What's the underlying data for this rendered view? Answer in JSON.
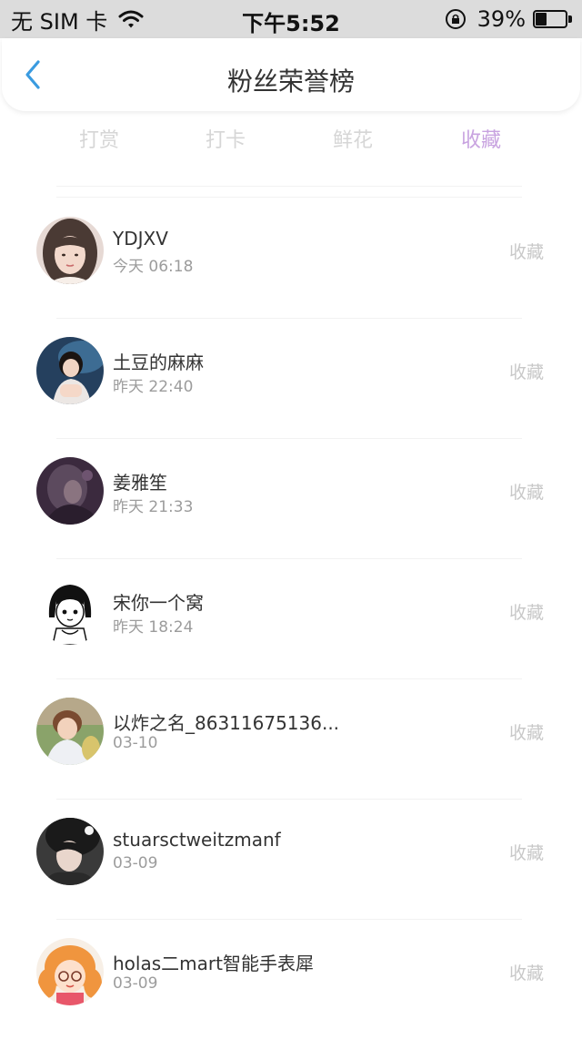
{
  "status_bar": {
    "carrier": "无 SIM 卡",
    "time": "下午5:52",
    "battery_text": "39%",
    "battery_level": 0.39
  },
  "nav": {
    "title": "粉丝荣誉榜",
    "back_icon": "chevron-left-icon"
  },
  "tabs": [
    {
      "label": "打赏",
      "active": false
    },
    {
      "label": "打卡",
      "active": false
    },
    {
      "label": "鲜花",
      "active": false
    },
    {
      "label": "收藏",
      "active": true
    }
  ],
  "colors": {
    "active_tab": "#c8a3e0",
    "inactive_tab": "#d6d6d6",
    "back_arrow": "#3a9be0",
    "action_text": "#c8c8c8"
  },
  "list": [
    {
      "name": "YDJXV",
      "time": "今天 06:18",
      "action": "收藏"
    },
    {
      "name": "土豆的麻麻",
      "time": "昨天 22:40",
      "action": "收藏"
    },
    {
      "name": "姜雅笙",
      "time": "昨天 21:33",
      "action": "收藏"
    },
    {
      "name": "宋你一个窝",
      "time": "昨天 18:24",
      "action": "收藏"
    },
    {
      "name": "以炸之名_86311675136...",
      "time": "03-10",
      "action": "收藏"
    },
    {
      "name": "stuarsctweitzmanf",
      "time": "03-09",
      "action": "收藏"
    },
    {
      "name": "holas二mart智能手表犀",
      "time": "03-09",
      "action": "收藏"
    }
  ]
}
